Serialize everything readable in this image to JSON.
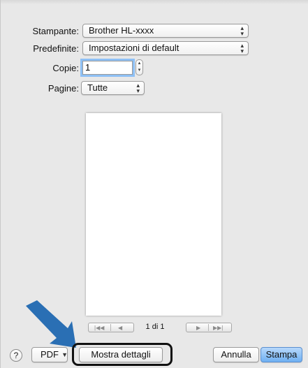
{
  "printer": {
    "label": "Stampante:",
    "value": "Brother HL-xxxx"
  },
  "presets": {
    "label": "Predefinite:",
    "value": "Impostazioni di default"
  },
  "copies": {
    "label": "Copie:",
    "value": "1"
  },
  "pages": {
    "label": "Pagine:",
    "value": "Tutte"
  },
  "preview_nav": {
    "page_indicator": "1 di 1"
  },
  "buttons": {
    "help": "?",
    "pdf": "PDF",
    "show_details": "Mostra dettagli",
    "cancel": "Annulla",
    "print": "Stampa"
  },
  "colors": {
    "callout_arrow": "#2a6fb4",
    "primary_button": "#6fb0f2",
    "focus_ring": "#8ec0f5"
  }
}
